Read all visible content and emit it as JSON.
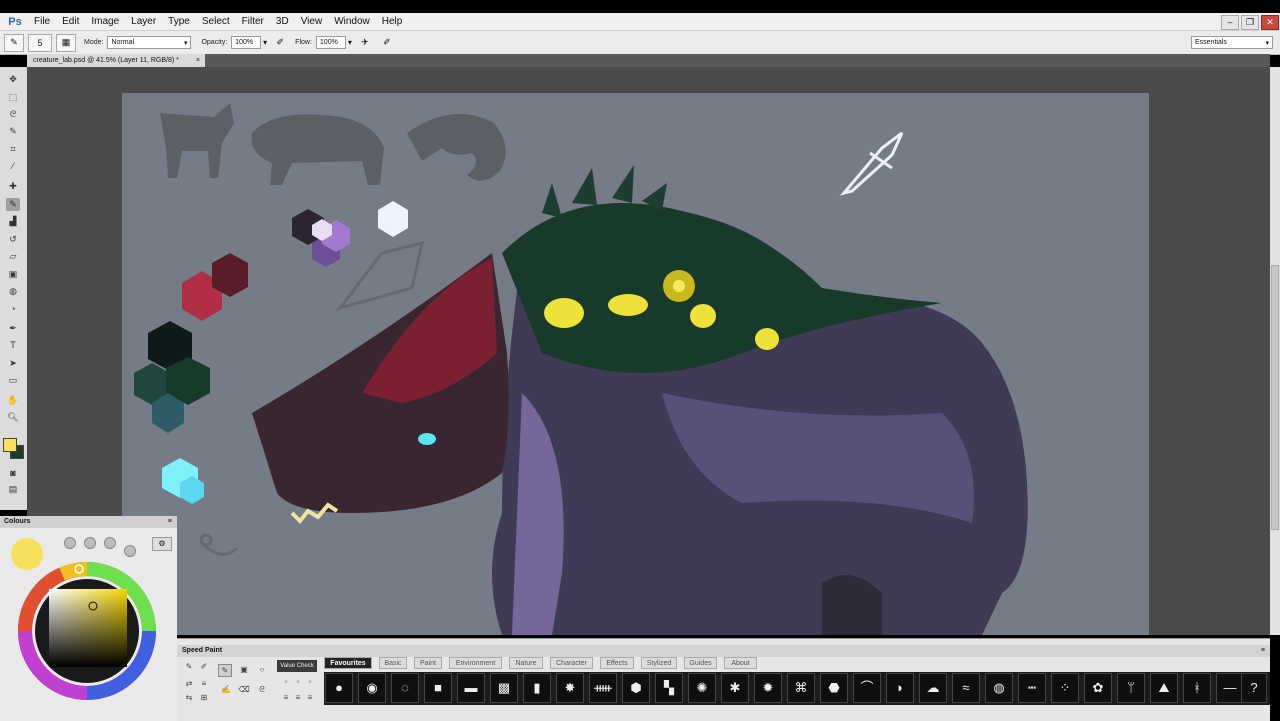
{
  "app": {
    "logo": "Ps"
  },
  "menu": [
    "File",
    "Edit",
    "Image",
    "Layer",
    "Type",
    "Select",
    "Filter",
    "3D",
    "View",
    "Window",
    "Help"
  ],
  "window_controls": [
    "–",
    "❐",
    "✕"
  ],
  "options_bar": {
    "brush_size": "5",
    "mode_label": "Mode:",
    "mode_value": "Normal",
    "opacity_label": "Opacity:",
    "opacity_value": "100%",
    "flow_label": "Flow:",
    "flow_value": "100%",
    "workspace": "Essentials"
  },
  "document_tab": {
    "title": "creature_lab.psd @ 41.5% (Layer 11, RGB/8) *",
    "close": "×"
  },
  "colour_panel": {
    "title": "Colours",
    "foreground_color": "#f7e15a"
  },
  "speed_paint": {
    "title": "Speed Paint",
    "value_check": "Value Check",
    "tabs": [
      "Favourites",
      "Basic",
      "Paint",
      "Environment",
      "Nature",
      "Character",
      "Effects",
      "Stylized",
      "Guides",
      "About"
    ],
    "active_tab": "Favourites",
    "help": "?"
  },
  "icons": {
    "tools": [
      "move-icon",
      "marquee-icon",
      "lasso-icon",
      "quick-select-icon",
      "crop-icon",
      "eyedropper-icon",
      "spot-heal-icon",
      "brush-icon",
      "clone-stamp-icon",
      "history-brush-icon",
      "eraser-icon",
      "gradient-icon",
      "blur-icon",
      "dodge-icon",
      "pen-icon",
      "type-icon",
      "path-select-icon",
      "shape-icon",
      "hand-icon",
      "zoom-icon"
    ]
  }
}
